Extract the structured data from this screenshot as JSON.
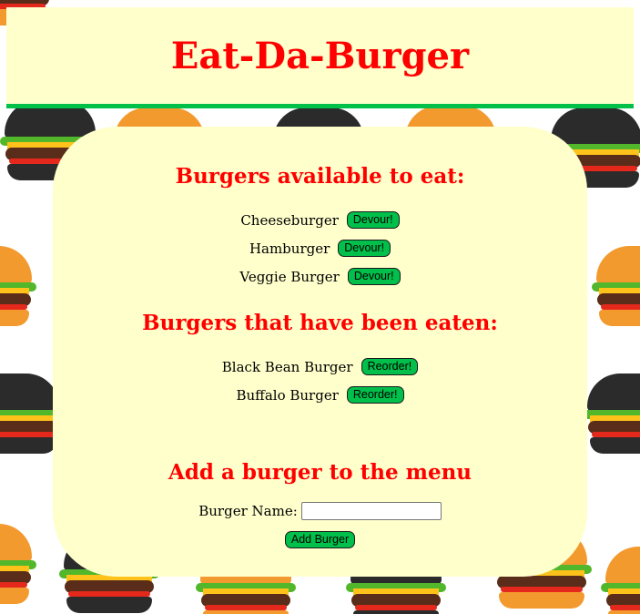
{
  "header": {
    "title": "Eat-Da-Burger"
  },
  "available": {
    "heading": "Burgers available to eat:",
    "items": [
      {
        "name": "Cheeseburger",
        "action": "Devour!"
      },
      {
        "name": "Hamburger",
        "action": "Devour!"
      },
      {
        "name": "Veggie Burger",
        "action": "Devour!"
      }
    ]
  },
  "eaten": {
    "heading": "Burgers that have been eaten:",
    "items": [
      {
        "name": "Black Bean Burger",
        "action": "Reorder!"
      },
      {
        "name": "Buffalo Burger",
        "action": "Reorder!"
      }
    ]
  },
  "add_form": {
    "heading": "Add a burger to the menu",
    "label": "Burger Name:",
    "value": "",
    "submit": "Add Burger"
  },
  "colors": {
    "heading_red": "#ff0000",
    "panel_bg": "#ffffcc",
    "button_green": "#00bf4a",
    "header_border": "#00c04a"
  },
  "background": {
    "icon": "burger-pattern"
  }
}
